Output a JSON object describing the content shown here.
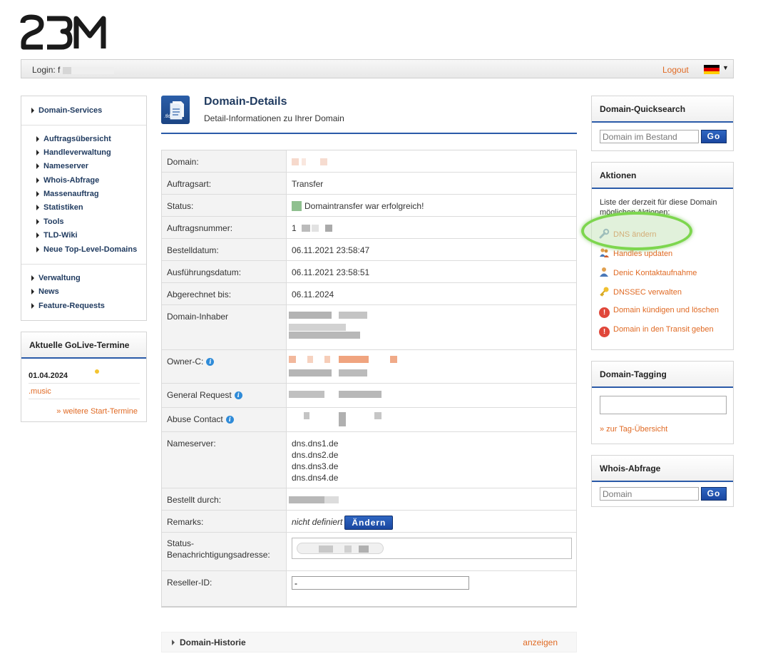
{
  "logo": {
    "text": "23M"
  },
  "topbar": {
    "login_label": "Login: f",
    "logout": "Logout",
    "language_flag": "de-flag-icon"
  },
  "leftnav": {
    "section": "Domain-Services",
    "items": [
      "Auftragsübersicht",
      "Handleverwaltung",
      "Nameserver",
      "Whois-Abfrage",
      "Massenauftrag",
      "Statistiken",
      "Tools",
      "TLD-Wiki",
      "Neue Top-Level-Domains"
    ],
    "bottom_items": [
      "Verwaltung",
      "News",
      "Feature-Requests"
    ]
  },
  "golive": {
    "title": "Aktuelle GoLive-Termine",
    "date": "01.04.2024",
    "tld": ".music",
    "more": "» weitere Start-Termine"
  },
  "main": {
    "icon_label": ".tld",
    "title": "Domain-Details",
    "subtitle": "Detail-Informationen zu Ihrer Domain"
  },
  "details": {
    "domain": {
      "label": "Domain:"
    },
    "auftragsart": {
      "label": "Auftragsart:",
      "value": "Transfer"
    },
    "status": {
      "label": "Status:",
      "value": "Domaintransfer war erfolgreich!",
      "color": "#8fc08f"
    },
    "auftragsnummer": {
      "label": "Auftragsnummer:",
      "value": "1"
    },
    "bestelldatum": {
      "label": "Bestelldatum:",
      "value": "06.11.2021 23:58:47"
    },
    "ausfuehrungsdatum": {
      "label": "Ausführungsdatum:",
      "value": "06.11.2021 23:58:51"
    },
    "abgerechnet": {
      "label": "Abgerechnet bis:",
      "value": "06.11.2024"
    },
    "inhaber": {
      "label": "Domain-Inhaber"
    },
    "owner": {
      "label": "Owner-C:"
    },
    "general": {
      "label": "General Request"
    },
    "abuse": {
      "label": "Abuse Contact"
    },
    "nameserver": {
      "label": "Nameserver:",
      "values": [
        "dns.dns1.de",
        "dns.dns2.de",
        "dns.dns3.de",
        "dns.dns4.de"
      ]
    },
    "bestellt": {
      "label": "Bestellt durch:"
    },
    "remarks": {
      "label": "Remarks:",
      "value": "nicht definiert",
      "button": "Ändern"
    },
    "statusnotify": {
      "label_1": "Status-",
      "label_2": "Benachrichtigungsadresse:"
    },
    "reseller": {
      "label": "Reseller-ID:",
      "value": "-"
    }
  },
  "historie": {
    "label": "Domain-Historie",
    "link": "anzeigen"
  },
  "quicksearch": {
    "title": "Domain-Quicksearch",
    "placeholder": "Domain im Bestand",
    "button": "Go"
  },
  "actions": {
    "title": "Aktionen",
    "intro": "Liste der derzeit für diese Domain möglichen Aktionen:",
    "items": [
      "DNS ändern",
      "Handles updaten",
      "Denic Kontaktaufnahme",
      "DNSSEC verwalten",
      "Domain kündigen und löschen",
      "Domain in den Transit geben"
    ],
    "highlight_color": "#7dd64e"
  },
  "tagging": {
    "title": "Domain-Tagging",
    "link": "» zur Tag-Übersicht"
  },
  "whois": {
    "title": "Whois-Abfrage",
    "placeholder": "Domain",
    "button": "Go"
  },
  "colors": {
    "accent": "#2a5aa8",
    "link": "#e06a24",
    "nav": "#1f3a5f"
  }
}
